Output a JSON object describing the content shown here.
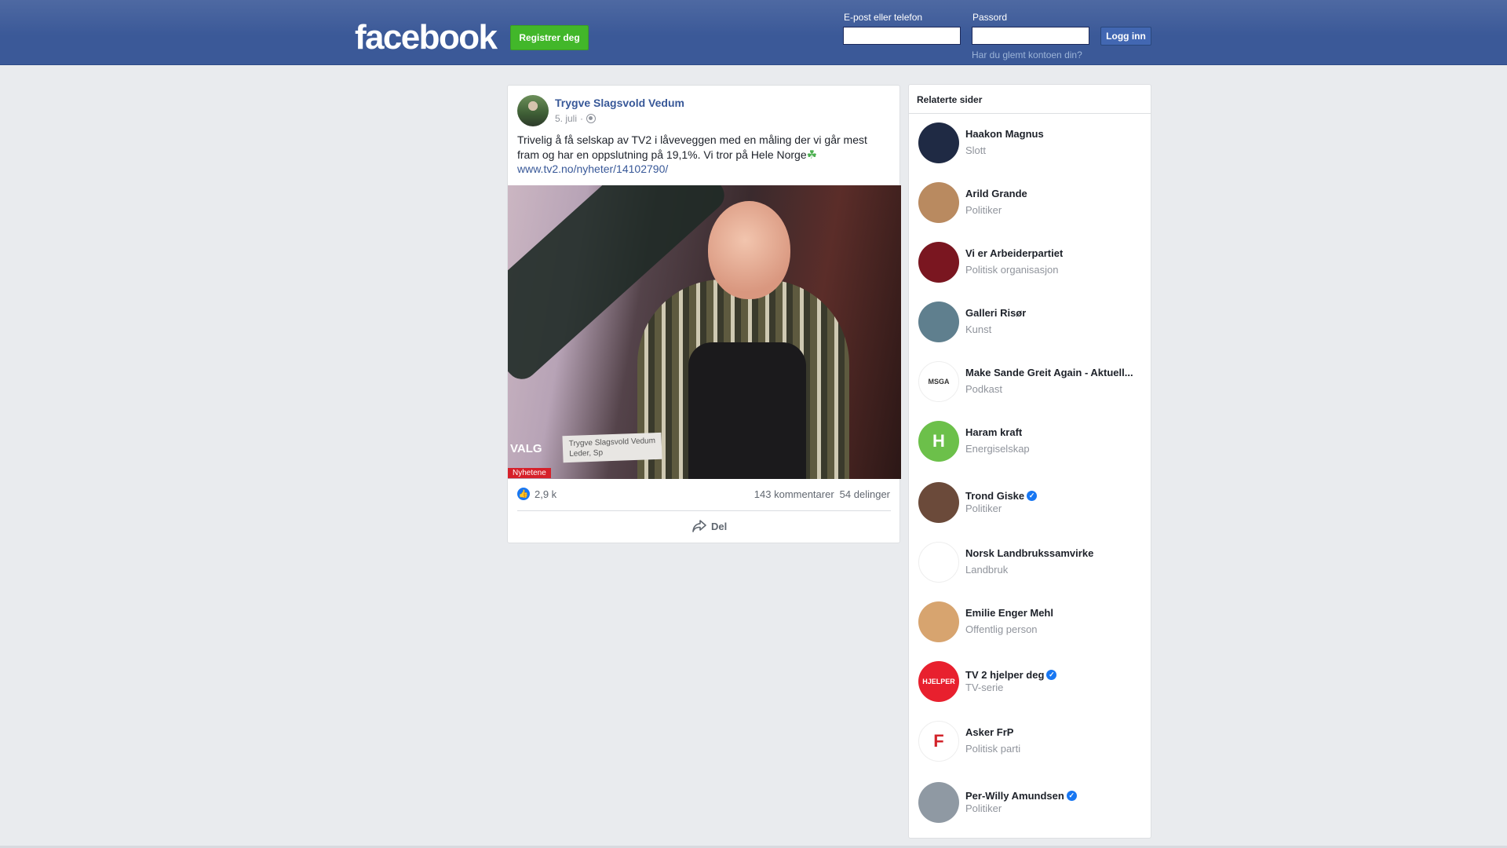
{
  "header": {
    "logo": "facebook",
    "register_label": "Registrer deg",
    "email_label": "E-post eller telefon",
    "password_label": "Passord",
    "login_label": "Logg inn",
    "forgot_label": "Har du glemt kontoen din?",
    "email_value": "",
    "password_value": ""
  },
  "post": {
    "author": "Trygve Slagsvold Vedum",
    "date": "5. juli",
    "meta_sep": "·",
    "text": "Trivelig å få selskap av TV2 i låveveggen med en måling der vi går mest fram og har en oppslutning på 19,1%. Vi tror på Hele Norge",
    "emoji": "☘",
    "link": "www.tv2.no/nyheter/14102790/",
    "image": {
      "caption_name": "Trygve Slagsvold Vedum",
      "caption_role": "Leder, Sp",
      "valg": "VALG",
      "channel": "Nyhetene"
    },
    "reactions_count": "2,9 k",
    "comments": "143 kommentarer",
    "shares": "54 delinger",
    "share_label": "Del"
  },
  "sidebar": {
    "title": "Relaterte sider",
    "items": [
      {
        "name": "Haakon Magnus",
        "category": "Slott",
        "verified": false,
        "avatar_text": "",
        "color": "#1f2a44"
      },
      {
        "name": "Arild Grande",
        "category": "Politiker",
        "verified": false,
        "avatar_text": "",
        "color": "#b98a60"
      },
      {
        "name": "Vi er Arbeiderpartiet",
        "category": "Politisk organisasjon",
        "verified": false,
        "avatar_text": "",
        "color": "#7a1620"
      },
      {
        "name": "Galleri Risør",
        "category": "Kunst",
        "verified": false,
        "avatar_text": "",
        "color": "#5f7f8e"
      },
      {
        "name": "Make Sande Greit Again - Aktuell...",
        "category": "Podkast",
        "verified": false,
        "avatar_text": "MSGA",
        "color": "#ffffff"
      },
      {
        "name": "Haram kraft",
        "category": "Energiselskap",
        "verified": false,
        "avatar_text": "H",
        "color": "#6cc04a"
      },
      {
        "name": "Trond Giske",
        "category": "Politiker",
        "verified": true,
        "avatar_text": "",
        "color": "#6b4a3a"
      },
      {
        "name": "Norsk Landbrukssamvirke",
        "category": "Landbruk",
        "verified": false,
        "avatar_text": "",
        "color": "#ffffff"
      },
      {
        "name": "Emilie Enger Mehl",
        "category": "Offentlig person",
        "verified": false,
        "avatar_text": "",
        "color": "#d7a46f"
      },
      {
        "name": "TV 2 hjelper deg",
        "category": "TV-serie",
        "verified": true,
        "avatar_text": "HJELPER",
        "color": "#e8202e"
      },
      {
        "name": "Asker FrP",
        "category": "Politisk parti",
        "verified": false,
        "avatar_text": "F",
        "color": "#ffffff"
      },
      {
        "name": "Per-Willy Amundsen",
        "category": "Politiker",
        "verified": true,
        "avatar_text": "",
        "color": "#8f99a3"
      }
    ]
  }
}
